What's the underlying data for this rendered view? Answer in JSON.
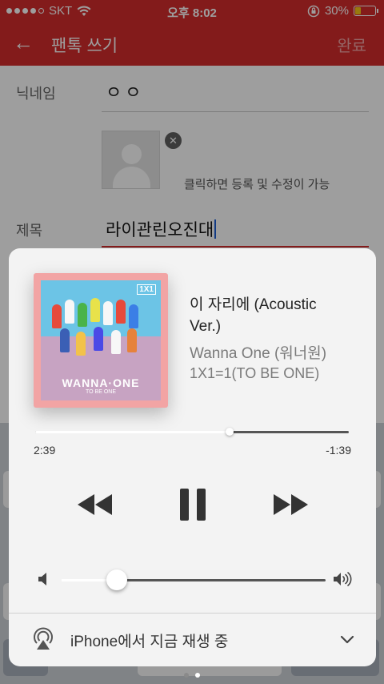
{
  "status_bar": {
    "carrier": "SKT",
    "time": "오후 8:02",
    "battery": "30%",
    "battery_level": 0.3,
    "signal_bars": 4
  },
  "header": {
    "title": "팬톡 쓰기",
    "done_label": "완료"
  },
  "form": {
    "nickname_label": "닉네임",
    "nickname_value": "ㅇㅇ",
    "photo_hint": "클릭하면 등록 및 수정이 가능",
    "title_label": "제목",
    "title_value": "라이관린오진대"
  },
  "player": {
    "song": "이 자리에 (Acoustic Ver.)",
    "artist": "Wanna One (워너원)",
    "album": "1X1=1(TO BE ONE)",
    "art_brand": "WANNA·ONE",
    "art_sub": "TO BE ONE",
    "art_tag": "1X1",
    "elapsed": "2:39",
    "remaining": "-1:39",
    "progress": 0.62,
    "volume": 0.21,
    "output_label": "iPhone에서 지금 재생 중"
  },
  "colors": {
    "accent_red": "#d32c2c",
    "card_bg": "#f3f3f3",
    "art_border": "#f2a4a4"
  },
  "pager": {
    "count": 2,
    "active": 1
  }
}
